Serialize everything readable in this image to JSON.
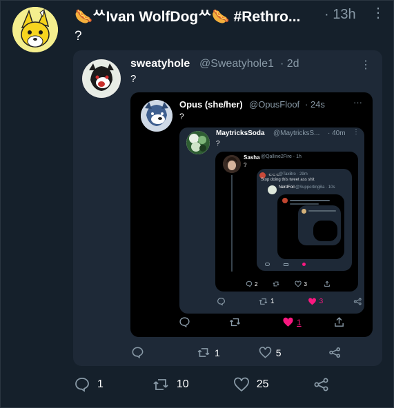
{
  "tweet": {
    "name": "🌭ᄊIvan WolfDogᄊ🌭 #Rethro...",
    "time": "· 13h",
    "text": "?",
    "more": "⋮",
    "actions": {
      "replies": "1",
      "retweets": "10",
      "likes": "25"
    }
  },
  "q1": {
    "name": "sweatyhole",
    "handle": "@Sweatyhole1",
    "time": "· 2d",
    "text": "?",
    "more": "⋮",
    "actions": {
      "retweets": "1",
      "likes": "5"
    }
  },
  "q2": {
    "name": "Opus (she/her)",
    "handle": "@OpusFloof",
    "time": "· 24s",
    "text": "?",
    "more": "···",
    "actions": {
      "likes": "1"
    }
  },
  "q3": {
    "name": "MaytricksSoda",
    "handle": "@MaytricksS...",
    "time": "· 40m",
    "text": "?",
    "more": "⋮",
    "actions": {
      "retweets": "1",
      "likes": "3"
    }
  },
  "q4": {
    "name": "Sasha",
    "handle": "@Qalline2Fire · 1h",
    "text": "?",
    "actions": {
      "replies": "2",
      "likes": "3"
    }
  },
  "q5": {
    "name": "ᄃᄃᄃ",
    "handle": "@TaxBro · 29m",
    "text": "Stop doing this tweet ass shit"
  },
  "q6": {
    "name": "NerdFoil",
    "handle": "@SupportingBa · 10s"
  },
  "colors": {
    "background": "#15202b",
    "card": "#1e2937",
    "inner": "#000000",
    "muted": "#8899a6",
    "like": "#f91880"
  }
}
